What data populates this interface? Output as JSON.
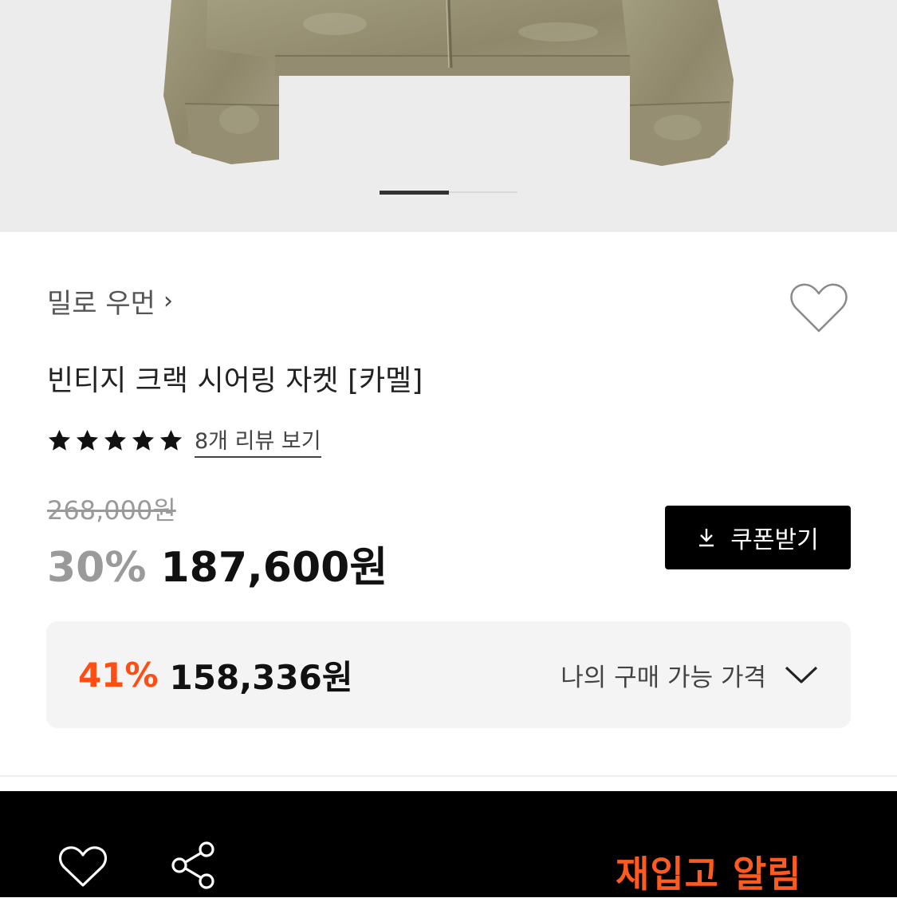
{
  "hero": {
    "image_alt": "빈티지 크랙 시어링 자켓",
    "slide_count": 2,
    "active_slide": 1
  },
  "product": {
    "brand": "밀로 우먼",
    "brand_chevron": "›",
    "title": "빈티지 크랙 시어링 자켓 [카멜]",
    "rating_stars": 5,
    "review_link": "8개 리뷰 보기",
    "original_price": "268,000원",
    "discount": "30%",
    "sale_price": "187,600원",
    "coupon_button": "쿠폰받기",
    "my_price": {
      "discount": "41%",
      "price": "158,336원",
      "label": "나의 구매 가능 가격"
    }
  },
  "bottom_bar": {
    "restock_label": "재입고 알림"
  },
  "colors": {
    "accent_orange": "#ff4d14",
    "restock_orange": "#ff5a1f",
    "hero_bg": "#ececec",
    "jacket": "#9c9478"
  },
  "icons": {
    "wishlist": "heart-outline-icon",
    "share": "share-icon",
    "download": "download-icon",
    "expand": "chevron-down-icon",
    "star": "star-icon"
  }
}
